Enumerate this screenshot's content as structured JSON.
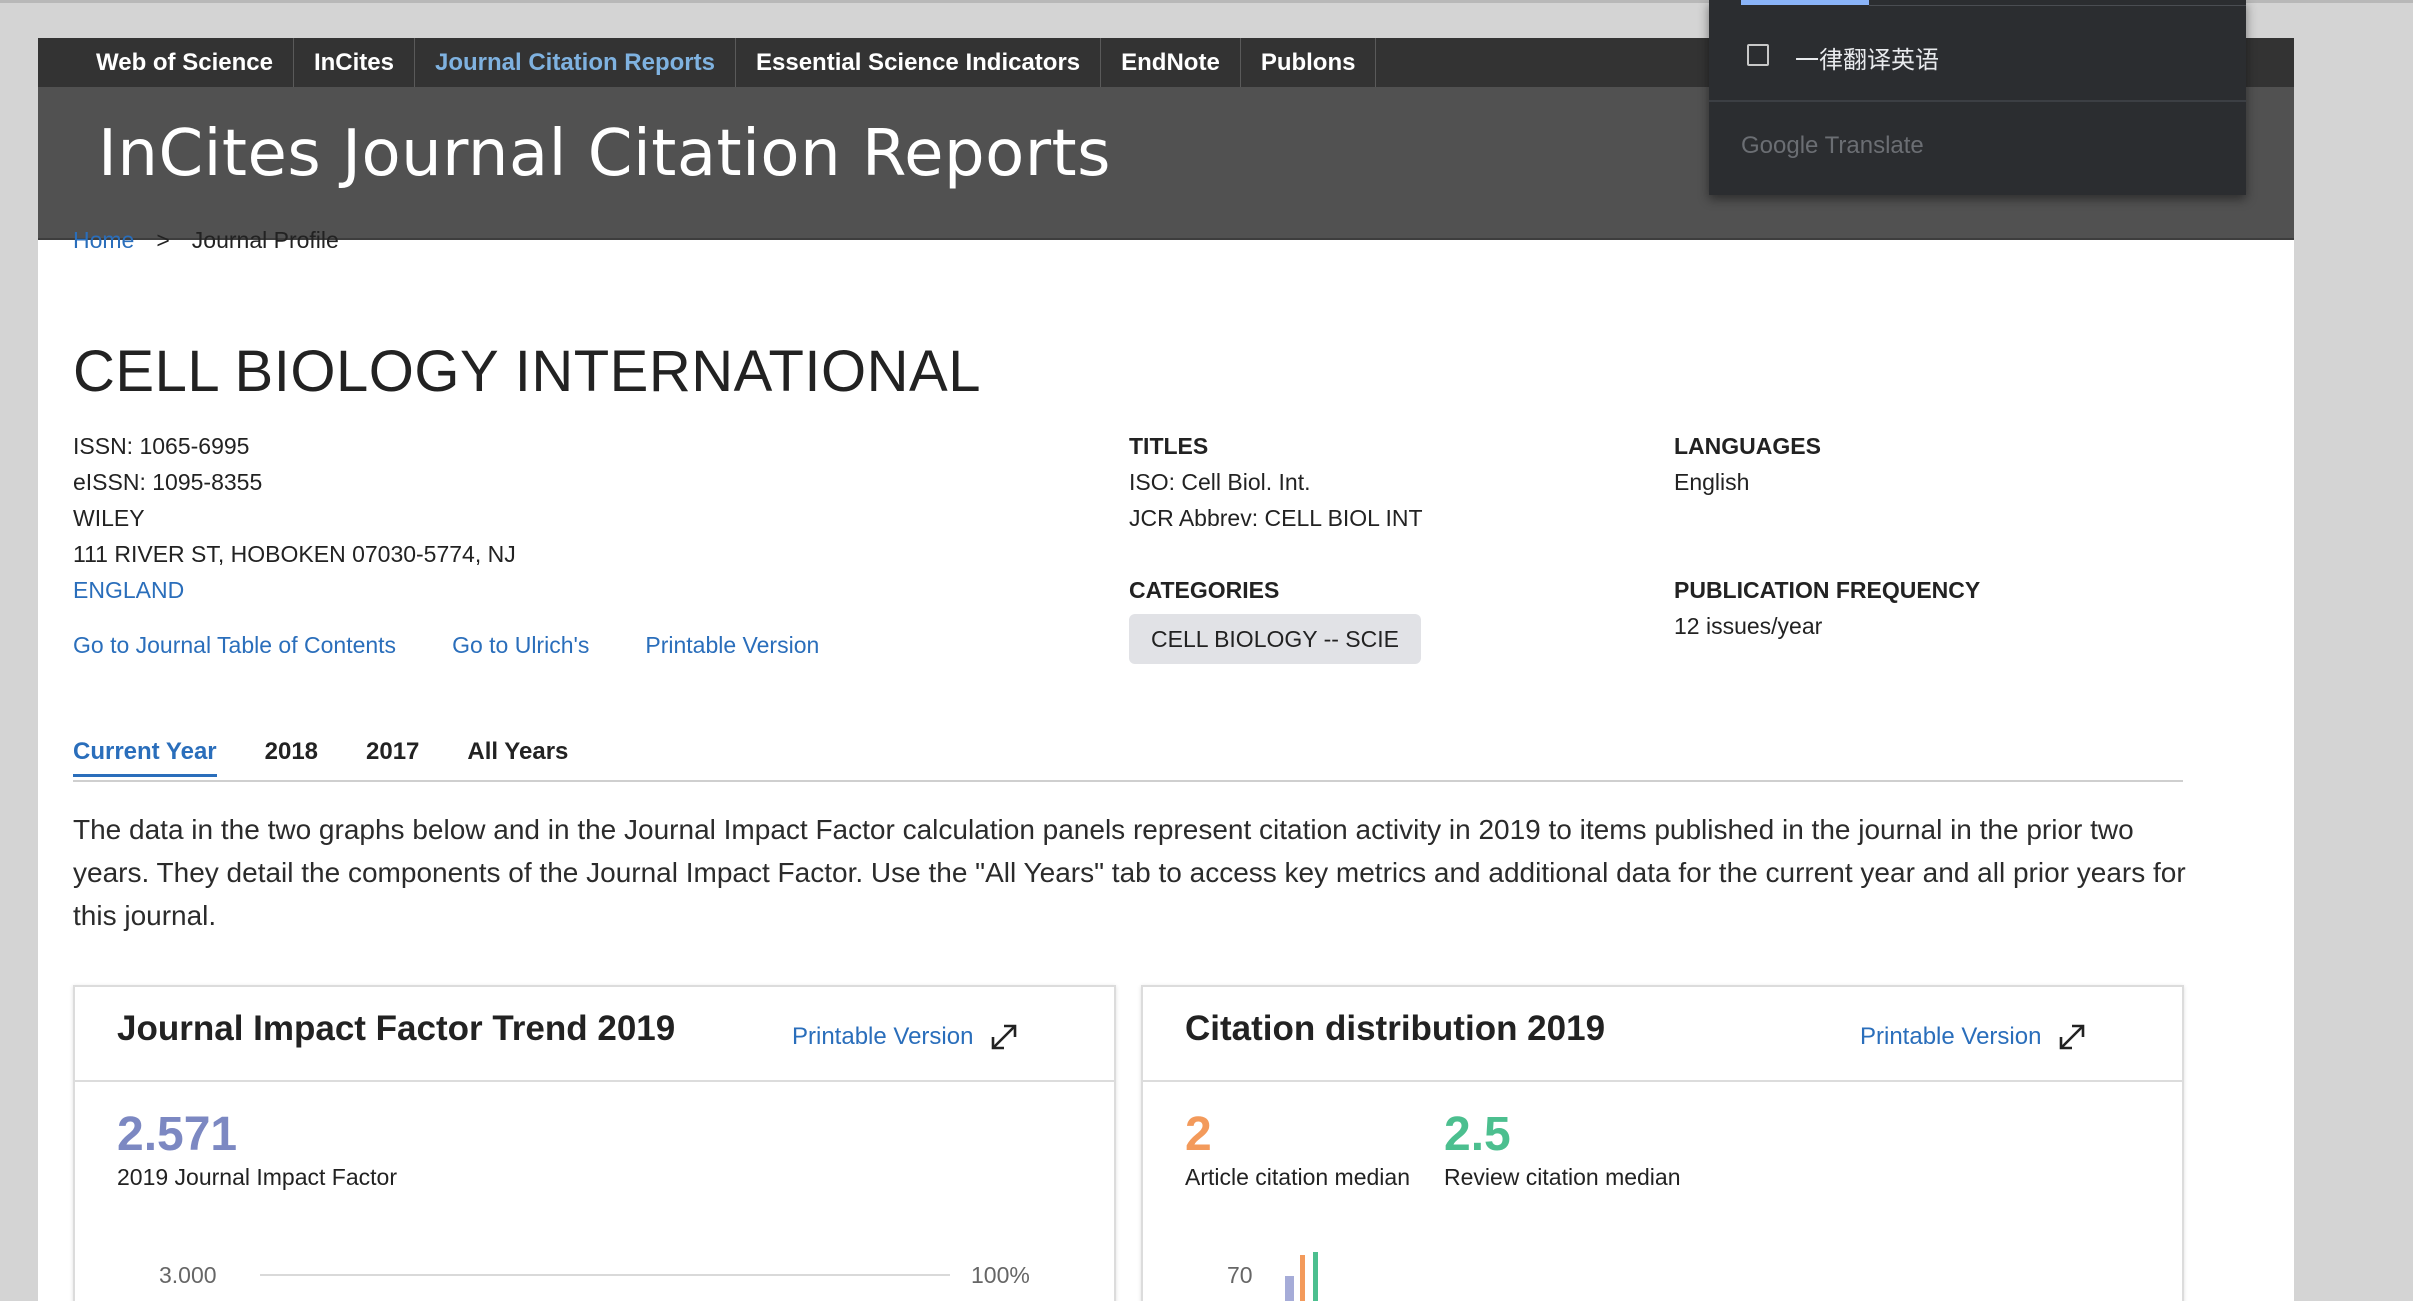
{
  "product_nav": [
    {
      "label": "Web of Science",
      "active": false
    },
    {
      "label": "InCites",
      "active": false
    },
    {
      "label": "Journal Citation Reports",
      "active": true
    },
    {
      "label": "Essential Science Indicators",
      "active": false
    },
    {
      "label": "EndNote",
      "active": false
    },
    {
      "label": "Publons",
      "active": false
    }
  ],
  "banner": {
    "title": "InCites Journal Citation Reports"
  },
  "breadcrumb": {
    "home": "Home",
    "separator": ">",
    "current": "Journal Profile"
  },
  "journal": {
    "title": "CELL BIOLOGY INTERNATIONAL",
    "issn": "ISSN: 1065-6995",
    "eissn": "eISSN: 1095-8355",
    "publisher": "WILEY",
    "address": "111 RIVER ST, HOBOKEN 07030-5774, NJ",
    "country": "ENGLAND"
  },
  "journal_links": {
    "toc": "Go to Journal Table of Contents",
    "ulrich": "Go to Ulrich's",
    "printable": "Printable Version"
  },
  "titles": {
    "label": "TITLES",
    "iso": "ISO: Cell Biol. Int.",
    "jcr_abbrev": "JCR Abbrev: CELL BIOL INT"
  },
  "categories": {
    "label": "CATEGORIES",
    "items": [
      "CELL BIOLOGY -- SCIE"
    ]
  },
  "languages": {
    "label": "LANGUAGES",
    "value": "English"
  },
  "publication_frequency": {
    "label": "PUBLICATION FREQUENCY",
    "value": "12 issues/year"
  },
  "tabs": [
    {
      "label": "Current Year",
      "active": true
    },
    {
      "label": "2018",
      "active": false
    },
    {
      "label": "2017",
      "active": false
    },
    {
      "label": "All Years",
      "active": false
    }
  ],
  "description": "The data in the two graphs below and in the Journal Impact Factor calculation panels represent citation activity in 2019 to items published in the journal in the prior two years. They detail the components of the Journal Impact Factor. Use the \"All Years\" tab to access key metrics and additional data for the current year and all prior years for this journal.",
  "jif_card": {
    "title": "Journal Impact Factor Trend 2019",
    "print_label": "Printable Version",
    "value": "2.571",
    "value_label": "2019 Journal Impact Factor",
    "axis_left": "3.000",
    "axis_right": "100%",
    "value_color": "#7c88c2"
  },
  "citation_card": {
    "title": "Citation distribution 2019",
    "print_label": "Printable Version",
    "article_median": "2",
    "article_median_label": "Article citation median",
    "review_median": "2.5",
    "review_median_label": "Review citation median",
    "axis_tick": "70",
    "article_color": "#f39a5b",
    "review_color": "#4cbf8f",
    "bar_colors": [
      "#a6acd8",
      "#f39a5b",
      "#4cbf8f"
    ]
  },
  "google_translate": {
    "option": "一律翻译英语",
    "brand": "Google Translate"
  },
  "colors": {
    "link": "#2a6ebb",
    "nav_bg": "#333333",
    "banner_bg": "#515151"
  }
}
